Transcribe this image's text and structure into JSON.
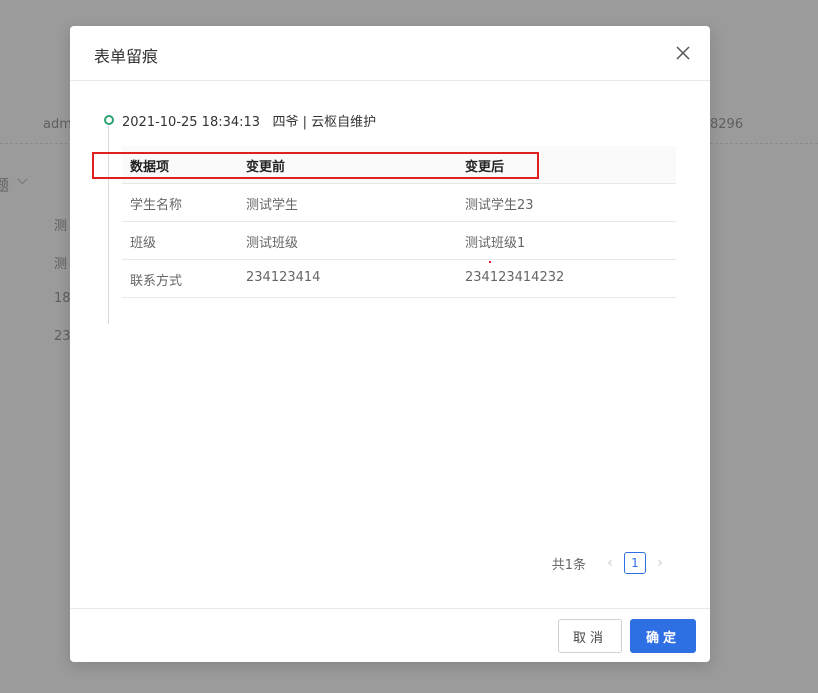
{
  "background": {
    "user_fragment": "adm",
    "phone_fragment": "8296",
    "filter_fragment": "题",
    "list_fragments": [
      "测",
      "测",
      "18",
      "23"
    ]
  },
  "modal": {
    "title": "表单留痕",
    "close_icon": "close-icon",
    "entry": {
      "timestamp": "2021-10-25 18:34:13",
      "author": "四爷 | 云枢自维护"
    },
    "table": {
      "headers": [
        "数据项",
        "变更前",
        "变更后"
      ],
      "rows": [
        [
          "学生名称",
          "测试学生",
          "测试学生23"
        ],
        [
          "班级",
          "测试班级",
          "测试班级1"
        ],
        [
          "联系方式",
          "234123414",
          "234123414232"
        ]
      ]
    },
    "pagination": {
      "total": "共1条",
      "current": "1",
      "prev_icon": "chevron-left-icon",
      "next_icon": "chevron-right-icon"
    },
    "footer": {
      "cancel_label": "取消",
      "ok_label": "确定"
    }
  },
  "colors": {
    "accent": "#2f6fe4",
    "timeline": "#2ba471",
    "highlight": "#e02020"
  }
}
